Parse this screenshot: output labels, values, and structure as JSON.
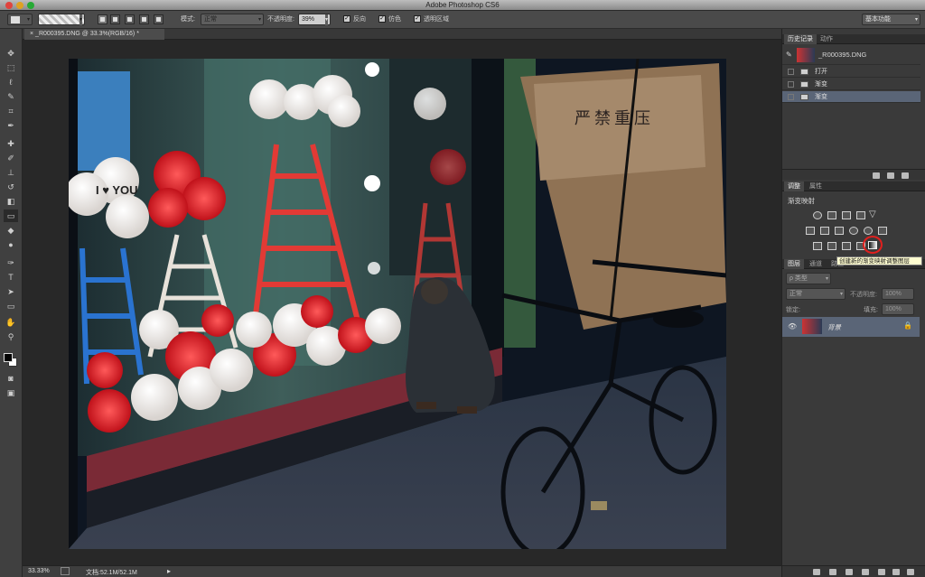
{
  "app": {
    "title": "Adobe Photoshop CS6",
    "workspace": "基本功能"
  },
  "options_bar": {
    "mode_label": "模式:",
    "mode_value": "正常",
    "opacity_label": "不透明度:",
    "opacity_value": "39%",
    "reverse_label": "反向",
    "dither_label": "仿色",
    "transparency_label": "透明区域"
  },
  "document": {
    "tab_label": "_R000395.DNG @ 33.3%(RGB/16) *",
    "zoom": "33.33%",
    "doc_size": "文档:52.1M/52.1M"
  },
  "history_panel": {
    "tabs": [
      "历史记录",
      "动作"
    ],
    "snapshot_name": "_R000395.DNG",
    "items": [
      {
        "label": "打开",
        "selected": false
      },
      {
        "label": "渐变",
        "selected": false
      },
      {
        "label": "渐变",
        "selected": true
      }
    ]
  },
  "adjustments_panel": {
    "tabs": [
      "调整",
      "属性"
    ],
    "heading": "渐变映射",
    "tooltip": "创建新的渐变映射调整图层"
  },
  "layers_panel": {
    "tabs": [
      "图层",
      "通道",
      "路径"
    ],
    "filter_placeholder": "ρ 类型",
    "blend_mode": "正常",
    "opacity_label": "不透明度:",
    "opacity_value": "100%",
    "lock_label": "锁定:",
    "fill_label": "填充:",
    "fill_value": "100%",
    "layers": [
      {
        "name": "背景",
        "visible": true,
        "locked": true
      }
    ]
  },
  "photo_text": {
    "sign_text": "严禁重压",
    "balloon_text": "I ♥ YOU"
  },
  "colors": {
    "accent_select": "#5a6577",
    "tooltip_bg": "#fffdd0",
    "highlight_circle": "#e0201e"
  }
}
